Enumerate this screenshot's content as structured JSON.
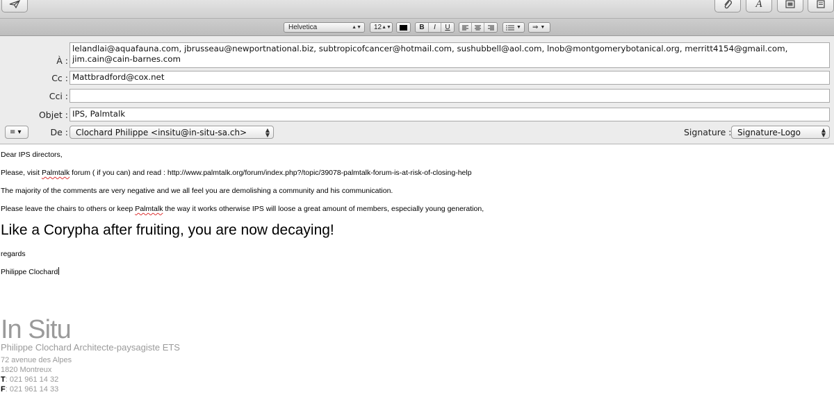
{
  "toolbar": {
    "send_icon": "paper-plane-icon",
    "attach_icon": "paperclip-icon",
    "fonts_icon": "font-A-icon",
    "photo_icon": "photo-browser-icon",
    "stationery_icon": "stationery-icon"
  },
  "format_bar": {
    "font": "Helvetica",
    "size": "12",
    "bold": "B",
    "italic": "I",
    "underline": "U"
  },
  "header": {
    "to_label": "À :",
    "to_value_line1": "lelandlai@aquafauna.com, jbrusseau@newportnational.biz, subtropicofcancer@hotmail.com, sushubbell@aol.com, lnob@montgomerybotanical.org, merritt4154@gmail.com,",
    "to_value_line2": "jim.cain@cain-barnes.com",
    "cc_label": "Cc :",
    "cc_value": "Mattbradford@cox.net",
    "bcc_label": "Cci :",
    "bcc_value": "",
    "subject_label": "Objet :",
    "subject_value": "IPS, Palmtalk",
    "from_label": "De :",
    "from_value": "Clochard Philippe <insitu@in-situ-sa.ch>",
    "signature_label": "Signature :",
    "signature_value": "Signature-Logo",
    "menu_button": "≡ ▾"
  },
  "body": {
    "greeting": "Dear IPS directors,",
    "line1_pre": "Please, visit ",
    "line1_word": "Palmtalk",
    "line1_post": " forum ( if you can)  and read : http://www.palmtalk.org/forum/index.php?/topic/39078-palmtalk-forum-is-at-risk-of-closing-help",
    "line2": "The majority of the comments are very negative and we all feel you are demolishing a community and his communication.",
    "line3_pre": "Please leave the chairs to others or keep ",
    "line3_word": "Palmtalk",
    "line3_post": " the way it works otherwise  IPS will loose a great amount of members, especially young generation,",
    "big_line": "Like a Corypha after fruiting, you are now decaying!",
    "regards": "regards",
    "signoff": "Philippe Clochard"
  },
  "signature": {
    "logo": "In Situ",
    "name": "Philippe Clochard",
    "title": " Architecte-paysagiste ETS",
    "address1": "72 avenue des Alpes",
    "address2": "1820 Montreux",
    "tel_prefix": "T",
    "tel": ": 021 961 14 32",
    "fax_prefix": "F",
    "fax": ": 021 961 14 33"
  }
}
